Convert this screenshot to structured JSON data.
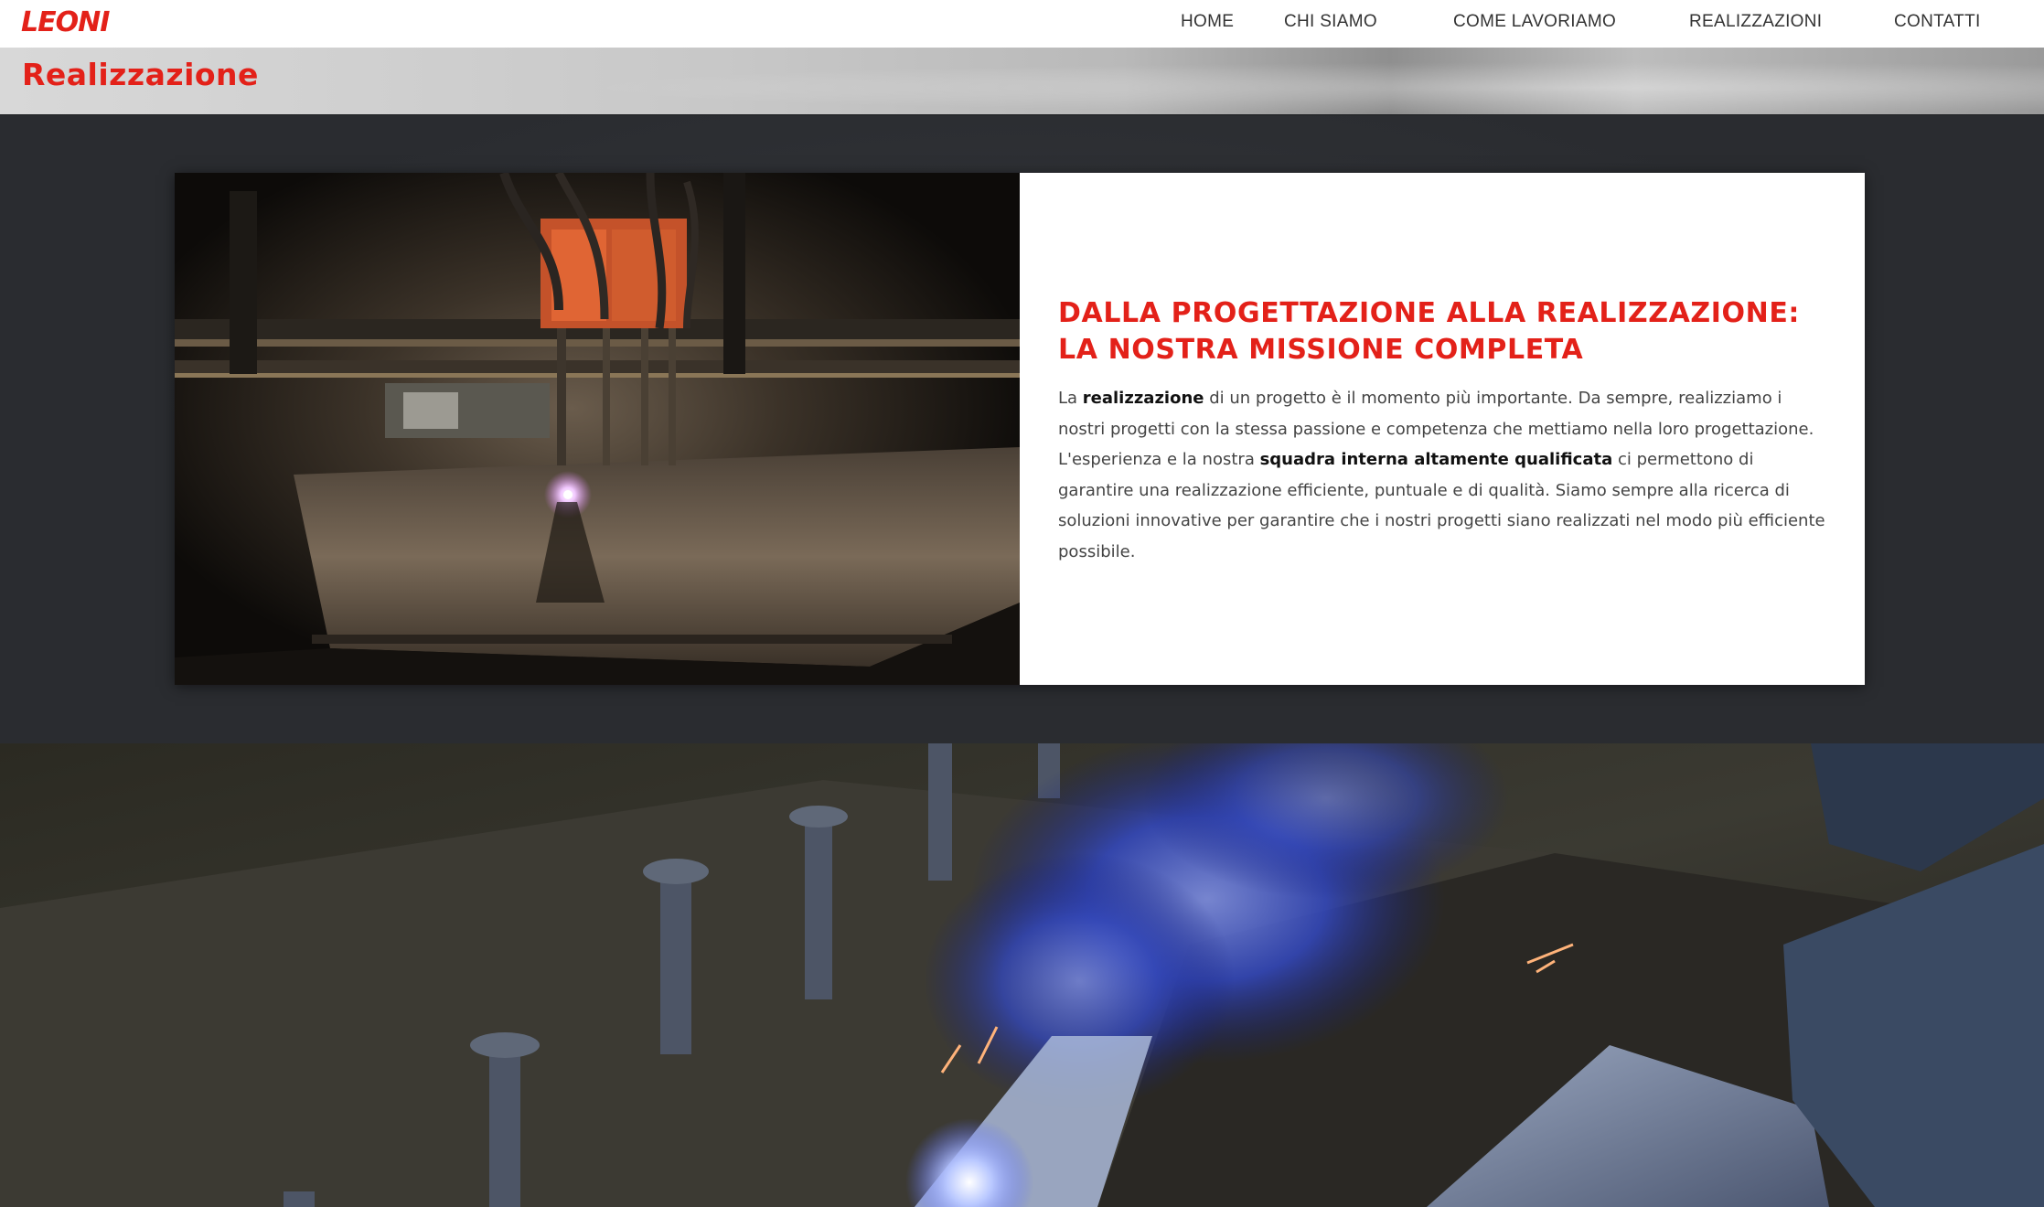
{
  "header": {
    "logo_text": "LEONI",
    "nav": [
      {
        "label": "HOME"
      },
      {
        "label": "CHI SIAMO"
      },
      {
        "label": "COME LAVORIAMO"
      },
      {
        "label": "REALIZZAZIONI"
      },
      {
        "label": "CONTATTI"
      }
    ]
  },
  "page": {
    "title": "Realizzazione"
  },
  "feature": {
    "heading": "DALLA PROGETTAZIONE ALLA REALIZZAZIONE: LA NOSTRA MISSIONE COMPLETA",
    "body": {
      "p1": "La ",
      "b1": "realizzazione",
      "p2": " di un progetto è il momento più importante. Da sempre, realizziamo i nostri progetti con la stessa passione e competenza che mettiamo nella loro progettazione. L'esperienza e la nostra ",
      "b2": "squadra interna altamente qualificata",
      "p3": " ci permettono di garantire una realizzazione efficiente, puntuale e di qualità. Siamo sempre alla ricerca di soluzioni innovative per garantire che i nostri progetti siano realizzati nel modo più efficiente possibile."
    }
  },
  "colors": {
    "brand_red": "#e32119",
    "dark_section": "#2a2c30",
    "nav_text": "#333333"
  }
}
